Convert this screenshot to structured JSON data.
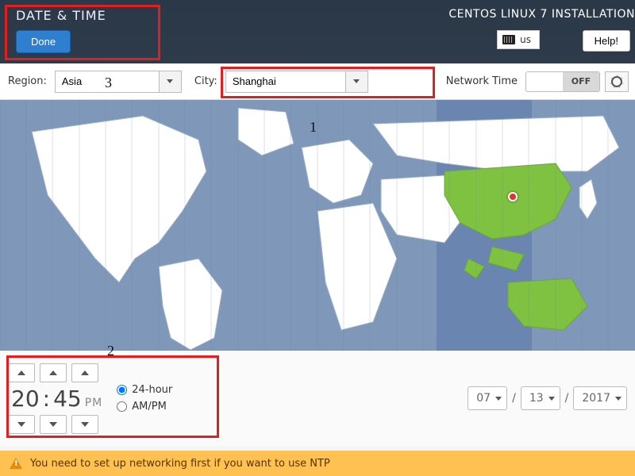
{
  "header": {
    "page_title": "DATE & TIME",
    "installer_title": "CENTOS LINUX 7 INSTALLATION",
    "done_label": "Done",
    "keyboard_layout": "us",
    "help_label": "Help!"
  },
  "toolbar": {
    "region_label": "Region:",
    "region_value": "Asia",
    "city_label": "City:",
    "city_value": "Shanghai",
    "network_time_label": "Network Time",
    "network_time_state": "OFF"
  },
  "time": {
    "hours": "20",
    "minutes": "45",
    "ampm": "PM",
    "format_24_label": "24-hour",
    "format_ampm_label": "AM/PM",
    "format_selected": "24-hour"
  },
  "date": {
    "month": "07",
    "day": "13",
    "year": "2017",
    "separator": "/"
  },
  "warning": {
    "text": "You need to set up networking first if you want to use NTP"
  },
  "annotations": {
    "n1": "1",
    "n2": "2",
    "n3": "3"
  }
}
